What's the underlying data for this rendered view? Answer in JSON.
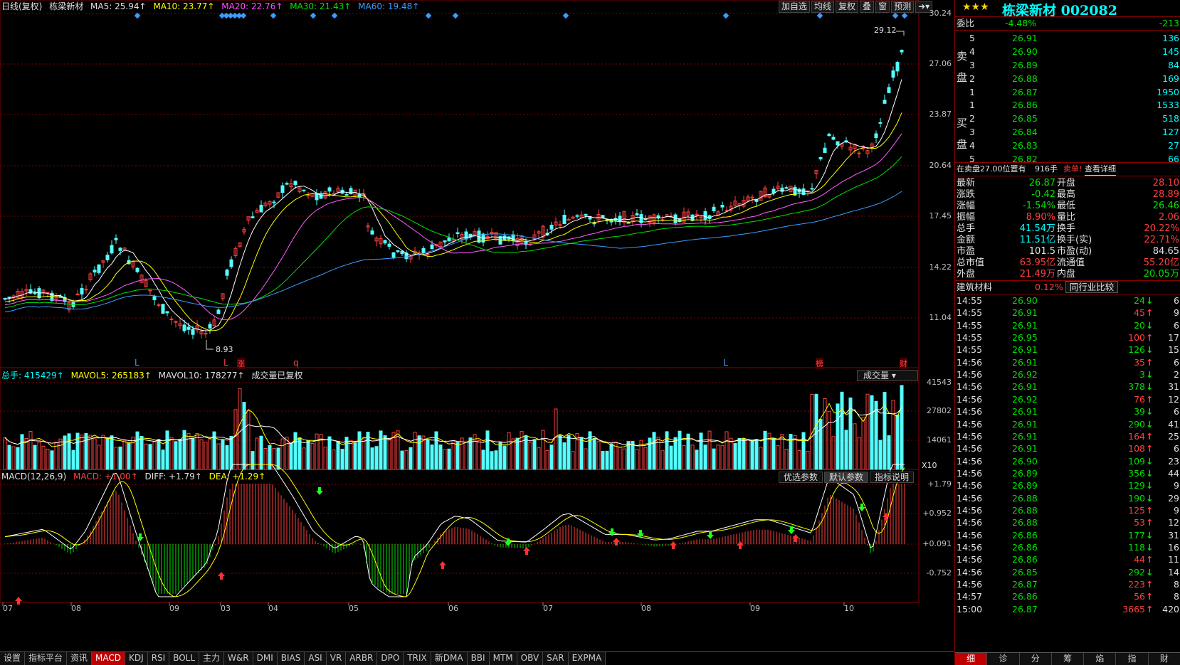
{
  "header": {
    "period": "日线(复权)",
    "stock_name": "栋梁新材",
    "ma5": "MA5: 25.94↑",
    "ma10": "MA10: 23.77↑",
    "ma20": "MA20: 22.76↑",
    "ma30": "MA30: 21.43↑",
    "ma60": "MA60: 19.48↑"
  },
  "toolbar": [
    "加自选",
    "均线",
    "复权",
    "叠",
    "窗",
    "预测"
  ],
  "toolbar_icon": "exit-arrow-icon",
  "price_axis": [
    "30.24",
    "27.06",
    "23.87",
    "20.64",
    "17.45",
    "14.22",
    "11.04"
  ],
  "price_annotations": {
    "high": "29.12",
    "low": "8.93"
  },
  "event_markers": [
    "L",
    "L",
    "涨",
    "q",
    "L",
    "榜",
    "财"
  ],
  "volume": {
    "legend": {
      "total": "总手: 415429↑",
      "mavol5": "MAVOL5: 265183↑",
      "mavol10": "MAVOL10: 178277↑",
      "note": "成交量已复权"
    },
    "selector": "成交量",
    "axis": [
      "41543",
      "27802",
      "14061"
    ],
    "unit": "X10"
  },
  "macd": {
    "legend": {
      "name": "MACD(12,26,9)",
      "macd": "MACD: +1.00↑",
      "diff": "DIFF: +1.79↑",
      "dea": "DEA: +1.29↑"
    },
    "buttons": [
      "优选参数",
      "默认参数",
      "指标说明"
    ],
    "axis": [
      "+1.79",
      "+0.952",
      "+0.091",
      "-0.752"
    ]
  },
  "date_axis": [
    "07",
    "08",
    "09",
    "03",
    "04",
    "05",
    "06",
    "07",
    "08",
    "09",
    "10"
  ],
  "bottom_tabs": [
    "设置",
    "指标平台",
    "资讯",
    "MACD",
    "KDJ",
    "RSI",
    "BOLL",
    "主力",
    "W&R",
    "DMI",
    "BIAS",
    "ASI",
    "VR",
    "ARBR",
    "DPO",
    "TRIX",
    "新DMA",
    "BBI",
    "MTM",
    "OBV",
    "SAR",
    "EXPMA"
  ],
  "active_tab": "MACD",
  "quote": {
    "stars": "★★★",
    "title": "栋梁新材 002082",
    "weibi": {
      "label": "委比",
      "pct": "-4.48%",
      "diff": "-213"
    },
    "sell_label": "卖盘",
    "buy_label": "买盘",
    "asks": [
      {
        "lvl": "5",
        "price": "26.91",
        "vol": "136"
      },
      {
        "lvl": "4",
        "price": "26.90",
        "vol": "145"
      },
      {
        "lvl": "3",
        "price": "26.89",
        "vol": "84"
      },
      {
        "lvl": "2",
        "price": "26.88",
        "vol": "169"
      },
      {
        "lvl": "1",
        "price": "26.87",
        "vol": "1950"
      }
    ],
    "bids": [
      {
        "lvl": "1",
        "price": "26.86",
        "vol": "1533"
      },
      {
        "lvl": "2",
        "price": "26.85",
        "vol": "518"
      },
      {
        "lvl": "3",
        "price": "26.84",
        "vol": "127"
      },
      {
        "lvl": "4",
        "price": "26.83",
        "vol": "27"
      },
      {
        "lvl": "5",
        "price": "26.82",
        "vol": "66"
      }
    ],
    "notice": "在卖盘27.00位置有",
    "notice_vol": "916手",
    "notice_action": "卖单!",
    "notice_link": "查看详细",
    "stats": [
      [
        "最新",
        "26.87",
        "开盘",
        "28.10"
      ],
      [
        "涨跌",
        "-0.42",
        "最高",
        "28.89"
      ],
      [
        "涨幅",
        "-1.54%",
        "最低",
        "26.46"
      ],
      [
        "振幅",
        "8.90%",
        "量比",
        "2.06"
      ],
      [
        "总手",
        "41.54万",
        "换手",
        "20.22%"
      ],
      [
        "金额",
        "11.51亿",
        "换手(实)",
        "22.71%"
      ],
      [
        "市盈",
        "101.5",
        "市盈(动)",
        "84.65"
      ],
      [
        "总市值",
        "63.95亿",
        "流通值",
        "55.20亿"
      ],
      [
        "外盘",
        "21.49万",
        "内盘",
        "20.05万"
      ]
    ],
    "sector": {
      "name": "建筑材料",
      "pct": "0.12%",
      "button": "同行业比较"
    },
    "ticks": [
      [
        "14:55",
        "26.90",
        "24",
        "6"
      ],
      [
        "14:55",
        "26.91",
        "45",
        "9"
      ],
      [
        "14:55",
        "26.91",
        "20",
        "6"
      ],
      [
        "14:55",
        "26.95",
        "100",
        "17"
      ],
      [
        "14:55",
        "26.91",
        "126",
        "15"
      ],
      [
        "14:56",
        "26.91",
        "35",
        "6"
      ],
      [
        "14:56",
        "26.92",
        "3",
        "2"
      ],
      [
        "14:56",
        "26.91",
        "378",
        "31"
      ],
      [
        "14:56",
        "26.92",
        "76",
        "12"
      ],
      [
        "14:56",
        "26.91",
        "39",
        "6"
      ],
      [
        "14:56",
        "26.91",
        "290",
        "41"
      ],
      [
        "14:56",
        "26.91",
        "164",
        "25"
      ],
      [
        "14:56",
        "26.91",
        "108",
        "6"
      ],
      [
        "14:56",
        "26.90",
        "109",
        "23"
      ],
      [
        "14:56",
        "26.89",
        "356",
        "44"
      ],
      [
        "14:56",
        "26.89",
        "129",
        "9"
      ],
      [
        "14:56",
        "26.88",
        "190",
        "29"
      ],
      [
        "14:56",
        "26.88",
        "125",
        "9"
      ],
      [
        "14:56",
        "26.88",
        "53",
        "12"
      ],
      [
        "14:56",
        "26.86",
        "177",
        "31"
      ],
      [
        "14:56",
        "26.86",
        "118",
        "16"
      ],
      [
        "14:56",
        "26.86",
        "44",
        "11"
      ],
      [
        "14:56",
        "26.85",
        "292",
        "14"
      ],
      [
        "14:56",
        "26.87",
        "223",
        "8"
      ],
      [
        "14:57",
        "26.86",
        "56",
        "8"
      ],
      [
        "15:00",
        "26.87",
        "3665",
        "420"
      ]
    ],
    "tick_dirs": [
      "d",
      "u",
      "d",
      "u",
      "d",
      "u",
      "d",
      "d",
      "u",
      "d",
      "d",
      "u",
      "u",
      "d",
      "d",
      "d",
      "d",
      "u",
      "u",
      "d",
      "d",
      "u",
      "d",
      "u",
      "u",
      "u"
    ],
    "bottom_tabs": [
      "细",
      "诊",
      "分",
      "筹",
      "焰",
      "指",
      "财"
    ],
    "active_bottom": "细"
  },
  "colors": {
    "up": "#ff4040",
    "down": "#54ffff",
    "ma5": "#ffffff",
    "ma10": "#ffff00",
    "ma20": "#ff60ff",
    "ma30": "#00e000",
    "ma60": "#3c9cff",
    "grid": "#8b0000"
  }
}
